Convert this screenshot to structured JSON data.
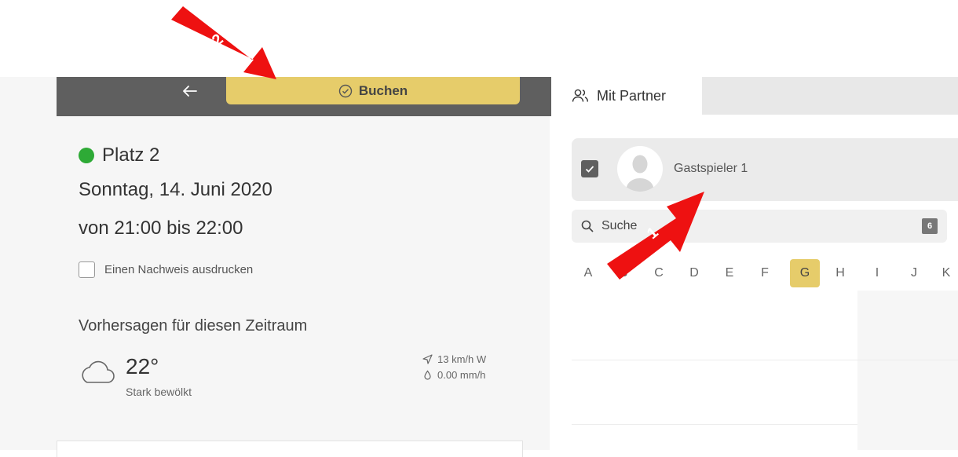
{
  "left": {
    "book_label": "Buchen",
    "place_name": "Platz 2",
    "date": "Sonntag, 14. Juni 2020",
    "time": "von 21:00 bis 22:00",
    "print_label": "Einen Nachweis ausdrucken",
    "forecast_title": "Vorhersagen für diesen Zeitraum",
    "temperature": "22°",
    "condition": "Stark bewölkt",
    "wind": "13 km/h W",
    "rain": "0.00 mm/h"
  },
  "right": {
    "tab_label": "Mit Partner",
    "player_name": "Gastspieler 1",
    "search_placeholder": "Suche",
    "search_count": "6",
    "alphabet": [
      "A",
      "B",
      "C",
      "D",
      "E",
      "F",
      "G",
      "H",
      "I",
      "J",
      "K"
    ],
    "active_letter": "G"
  },
  "annotations": {
    "arrow_1": "1",
    "arrow_2": "2"
  },
  "colors": {
    "accent": "#e6cc6a",
    "status_green": "#2eaa36",
    "topbar": "#5f5f5f",
    "annotation_red": "#ee1111"
  }
}
